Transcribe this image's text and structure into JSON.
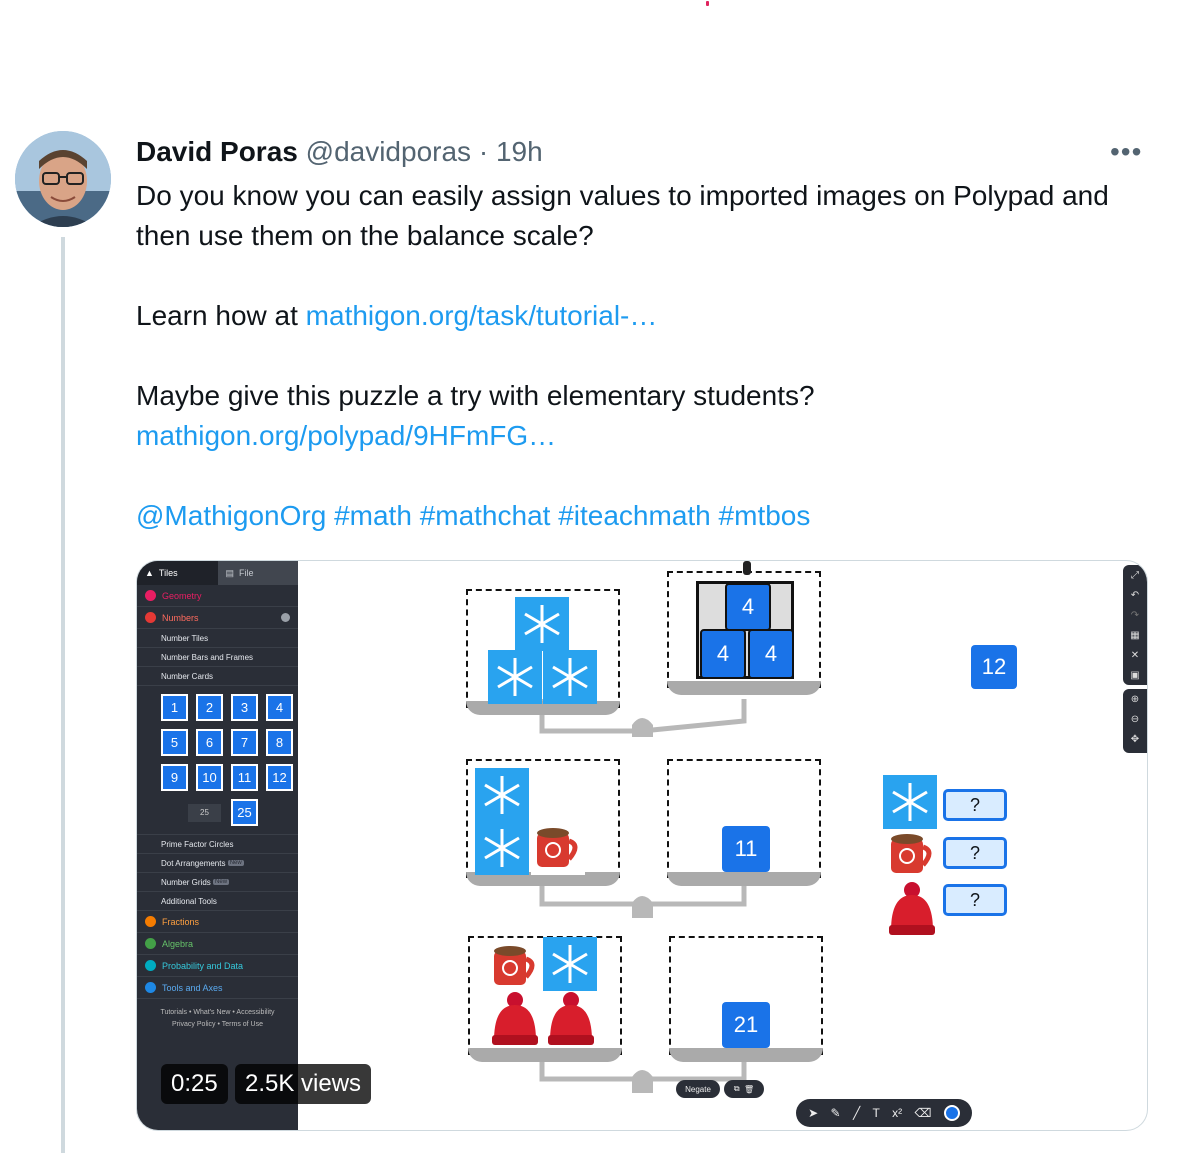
{
  "tweet": {
    "author_name": "David Poras",
    "handle": "@davidporas",
    "separator": "·",
    "time": "19h",
    "more_label": "•••",
    "line1": "Do you know you can easily assign values to imported images on Polypad and then use them on the balance scale?",
    "learn_prefix": "Learn how at ",
    "link1": "mathigon.org/task/tutorial-…",
    "line3": "Maybe give this puzzle a try with elementary students?",
    "link2": "mathigon.org/polypad/9HFmFG…",
    "mention": "@MathigonOrg",
    "hashtags": [
      "#math",
      "#mathchat",
      "#iteachmath",
      "#mtbos"
    ]
  },
  "video": {
    "duration": "0:25",
    "views": "2.5K views"
  },
  "polypad": {
    "tabs": {
      "tiles": "Tiles",
      "file": "File"
    },
    "categories": {
      "geometry": "Geometry",
      "numbers": "Numbers",
      "fractions": "Fractions",
      "algebra": "Algebra",
      "probability": "Probability and Data",
      "tools": "Tools and Axes"
    },
    "numbers_sub": [
      "Number Tiles",
      "Number Bars and Frames",
      "Number Cards"
    ],
    "number_cards": [
      "1",
      "2",
      "3",
      "4",
      "5",
      "6",
      "7",
      "8",
      "9",
      "10",
      "11",
      "12"
    ],
    "custom_input": "25",
    "custom_card": "25",
    "more_sub": [
      "Prime Factor Circles",
      "Dot Arrangements",
      "Number Grids",
      "Additional Tools"
    ],
    "new_tag": "New",
    "footer_line1": "Tutorials • What's New • Accessibility",
    "footer_line2": "Privacy Policy • Terms of Use",
    "canvas_tiles": {
      "stack_top": "4",
      "stack_left": "4",
      "stack_right": "4",
      "free_tile": "12",
      "scale2_right": "11",
      "scale3_right": "21"
    },
    "question_marks": [
      "?",
      "?",
      "?"
    ],
    "negate_label": "Negate"
  },
  "colors": {
    "link": "#1d9bf0",
    "tile_blue": "#1a73e8",
    "sidebar_bg": "#2a2e37",
    "numbers_accent": "#e53935",
    "fractions_accent": "#f57c00",
    "algebra_accent": "#43a047",
    "probability_accent": "#00acc1",
    "tools_accent": "#1e88e5",
    "geometry_accent": "#e91e63"
  }
}
